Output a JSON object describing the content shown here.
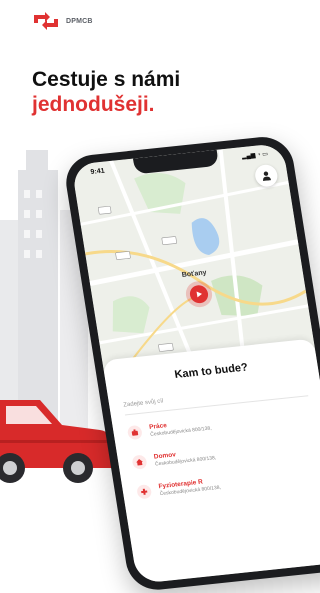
{
  "brand": {
    "name": "DPMCB",
    "accent": "#e03232"
  },
  "headline": {
    "line1": "Cestuje s námi",
    "line2": "jednodušeji."
  },
  "phone": {
    "status_time": "9:41",
    "map_label": "Boťany",
    "panel_title": "Kam to bude?",
    "search_placeholder": "Zadejte svůj cíl",
    "destinations": [
      {
        "name": "Práce",
        "address": "Českobudějovická 800/138,",
        "icon": "briefcase-icon"
      },
      {
        "name": "Domov",
        "address": "Českobudějovická 800/138,",
        "icon": "home-icon"
      },
      {
        "name": "Fyzioterapie R",
        "address": "Českobudějovická 800/138,",
        "icon": "medical-icon"
      }
    ]
  }
}
